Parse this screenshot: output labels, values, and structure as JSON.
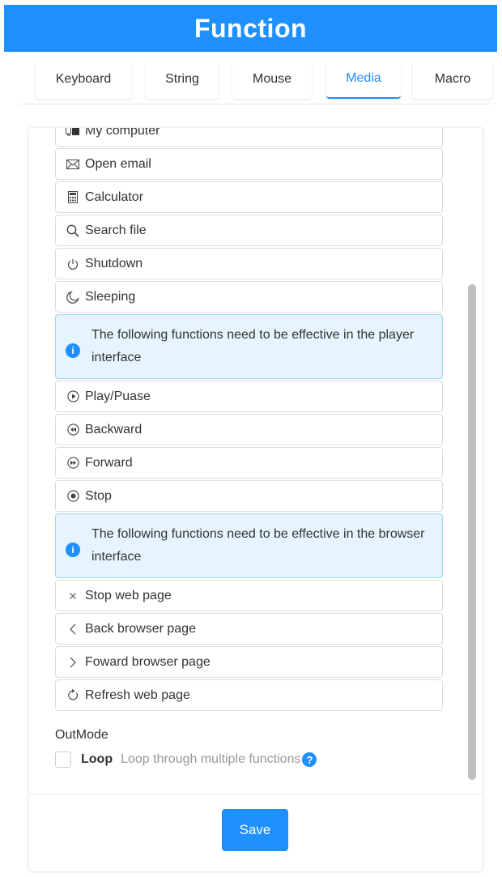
{
  "header": {
    "title": "Function"
  },
  "tabs": [
    {
      "label": "Keyboard"
    },
    {
      "label": "String"
    },
    {
      "label": "Mouse"
    },
    {
      "label": "Media"
    },
    {
      "label": "Macro"
    }
  ],
  "active_tab": "Media",
  "list": {
    "items_top": [
      {
        "label": "My computer",
        "icon": "computer-icon"
      },
      {
        "label": "Open email",
        "icon": "email-icon"
      },
      {
        "label": "Calculator",
        "icon": "calculator-icon"
      },
      {
        "label": "Search file",
        "icon": "search-icon"
      },
      {
        "label": "Shutdown",
        "icon": "power-icon"
      },
      {
        "label": "Sleeping",
        "icon": "moon-icon"
      }
    ],
    "notice_player": "The following functions need to be effective in the player interface",
    "items_player": [
      {
        "label": "Play/Puase",
        "icon": "play-icon"
      },
      {
        "label": "Backward",
        "icon": "rewind-icon"
      },
      {
        "label": "Forward",
        "icon": "fast-forward-icon"
      },
      {
        "label": "Stop",
        "icon": "stop-icon"
      }
    ],
    "notice_browser": "The following functions need to be effective in the browser interface",
    "items_browser": [
      {
        "label": "Stop web page",
        "icon": "close-icon"
      },
      {
        "label": "Back browser page",
        "icon": "chevron-left-icon"
      },
      {
        "label": "Foward browser page",
        "icon": "chevron-right-icon"
      },
      {
        "label": "Refresh web page",
        "icon": "refresh-icon"
      }
    ]
  },
  "outmode": {
    "label": "OutMode",
    "loop_label": "Loop",
    "loop_description": "Loop through multiple functions",
    "loop_checked": false
  },
  "footer": {
    "save_label": "Save"
  },
  "colors": {
    "accent": "#1e90ff",
    "notice_bg": "#e6f4fd",
    "notice_border": "#9fd4f3"
  }
}
